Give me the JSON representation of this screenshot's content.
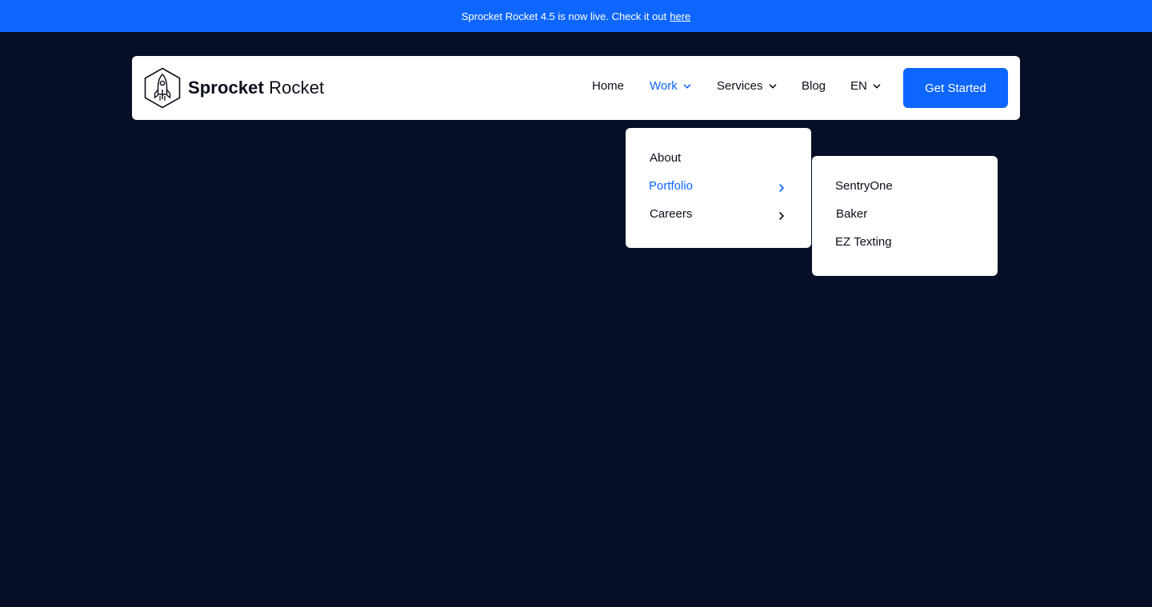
{
  "announcement": {
    "text": "Sprocket Rocket 4.5 is now live. Check it out",
    "link_label": "here"
  },
  "brand": {
    "name_bold": "Sprocket",
    "name_light": "Rocket",
    "icon": "rocket-hexagon-logo"
  },
  "nav": {
    "items": [
      {
        "label": "Home",
        "has_dropdown": false,
        "active": false
      },
      {
        "label": "Work",
        "has_dropdown": true,
        "active": true
      },
      {
        "label": "Services",
        "has_dropdown": true,
        "active": false
      },
      {
        "label": "Blog",
        "has_dropdown": false,
        "active": false
      },
      {
        "label": "EN",
        "has_dropdown": true,
        "active": false
      }
    ],
    "cta_label": "Get Started"
  },
  "work_menu": {
    "items": [
      {
        "label": "About",
        "has_submenu": false,
        "active": false
      },
      {
        "label": "Portfolio",
        "has_submenu": true,
        "active": true
      },
      {
        "label": "Careers",
        "has_submenu": true,
        "active": false
      }
    ]
  },
  "portfolio_submenu": {
    "items": [
      {
        "label": "SentryOne"
      },
      {
        "label": "Baker"
      },
      {
        "label": "EZ Texting"
      }
    ]
  },
  "colors": {
    "background": "#060f26",
    "accent": "#0d66ff",
    "text": "#0b0f1a",
    "surface": "#ffffff"
  }
}
